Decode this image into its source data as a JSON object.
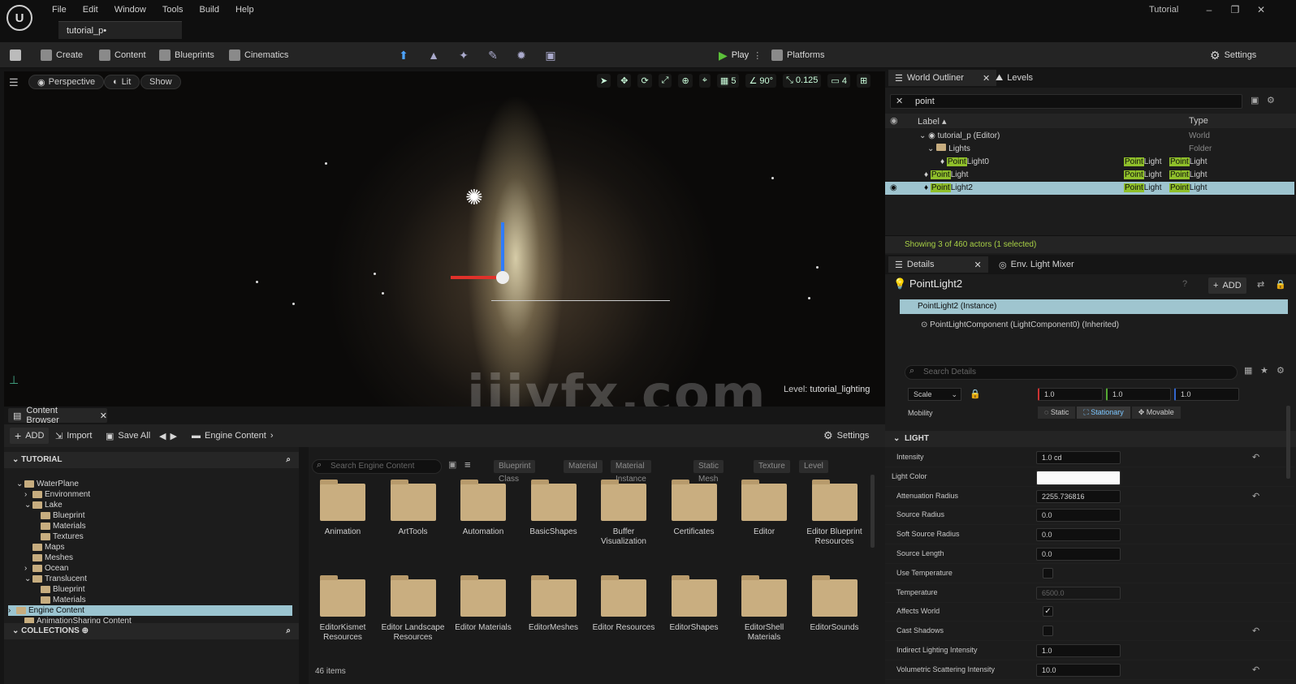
{
  "app": {
    "menu": [
      "File",
      "Edit",
      "Window",
      "Tools",
      "Build",
      "Help"
    ],
    "doc_tab": "tutorial_p•",
    "window_title": "Tutorial"
  },
  "toolbar": {
    "create": "Create",
    "content": "Content",
    "blueprints": "Blueprints",
    "cinematics": "Cinematics",
    "play": "Play",
    "platforms": "Platforms",
    "settings": "Settings"
  },
  "viewport": {
    "perspective": "Perspective",
    "lit": "Lit",
    "show": "Show",
    "grid_snap": "5",
    "rot_snap": "90°",
    "scale_snap": "0.125",
    "cam_speed": "4",
    "level_label": "Level:",
    "level_name": "tutorial_lighting",
    "watermark": "iiivfx.com"
  },
  "content_browser": {
    "tab": "Content Browser",
    "add": "ADD",
    "import": "Import",
    "save_all": "Save All",
    "path": "Engine Content",
    "settings": "Settings",
    "section_tutorial": "TUTORIAL",
    "section_collections": "COLLECTIONS",
    "tree": [
      {
        "label": "WaterPlane",
        "indent": 1,
        "arrow": "⌄"
      },
      {
        "label": "Environment",
        "indent": 2,
        "arrow": "›"
      },
      {
        "label": "Lake",
        "indent": 2,
        "arrow": "⌄"
      },
      {
        "label": "Blueprint",
        "indent": 3,
        "arrow": ""
      },
      {
        "label": "Materials",
        "indent": 3,
        "arrow": ""
      },
      {
        "label": "Textures",
        "indent": 3,
        "arrow": ""
      },
      {
        "label": "Maps",
        "indent": 2,
        "arrow": ""
      },
      {
        "label": "Meshes",
        "indent": 2,
        "arrow": ""
      },
      {
        "label": "Ocean",
        "indent": 2,
        "arrow": "›"
      },
      {
        "label": "Translucent",
        "indent": 2,
        "arrow": "⌄"
      },
      {
        "label": "Blueprint",
        "indent": 3,
        "arrow": ""
      },
      {
        "label": "Materials",
        "indent": 3,
        "arrow": ""
      },
      {
        "label": "Engine Content",
        "indent": 0,
        "arrow": "›",
        "selected": true
      },
      {
        "label": "AnimationSharing Content",
        "indent": 1,
        "arrow": ""
      }
    ],
    "search_placeholder": "Search Engine Content",
    "filters": [
      "Blueprint Class",
      "Material",
      "Material Instance",
      "Static Mesh",
      "Texture",
      "Level"
    ],
    "folders": [
      "Animation",
      "ArtTools",
      "Automation",
      "BasicShapes",
      "Buffer Visualization",
      "Certificates",
      "Editor",
      "Editor Blueprint Resources",
      "EditorKismet Resources",
      "Editor Landscape Resources",
      "Editor Materials",
      "EditorMeshes",
      "Editor Resources",
      "EditorShapes",
      "EditorShell Materials",
      "EditorSounds"
    ],
    "item_count": "46 items"
  },
  "outliner": {
    "tab": "World Outliner",
    "levels_tab": "Levels",
    "search_value": "point",
    "col_label": "Label",
    "col_type": "Type",
    "rows": [
      {
        "label": "tutorial_p (Editor)",
        "type": "World",
        "indent": 0
      },
      {
        "label": "Lights",
        "type": "Folder",
        "indent": 1
      }
    ],
    "light_rows": [
      {
        "hl": "Point",
        "rest": "Light0",
        "t_hl": "",
        "t_rest": "PointLight",
        "type_hl": "Point",
        "type_rest": "Light"
      },
      {
        "hl": "Point",
        "rest": "Light",
        "t_hl": "",
        "t_rest": "PointLight",
        "type_hl": "Point",
        "type_rest": "Light"
      },
      {
        "hl": "Point",
        "rest": "Light2",
        "t_hl": "",
        "t_rest": "PointLight",
        "type_hl": "Point",
        "type_rest": "Light"
      }
    ],
    "status": "Showing 3 of 460 actors (1 selected)"
  },
  "details": {
    "tab": "Details",
    "env_tab": "Env. Light Mixer",
    "actor_name": "PointLight2",
    "add": "ADD",
    "instance": "PointLight2 (Instance)",
    "component": "PointLightComponent (LightComponent0) (Inherited)",
    "search_placeholder": "Search Details",
    "scale_label": "Scale",
    "scale_values": [
      "1.0",
      "1.0",
      "1.0"
    ],
    "mobility_label": "Mobility",
    "mobility_opts": [
      "Static",
      "Stationary",
      "Movable"
    ],
    "light_section": "LIGHT",
    "props": [
      {
        "label": "Intensity",
        "value": "1.0 cd",
        "kind": "text",
        "reset": true
      },
      {
        "label": "Light Color",
        "value": "",
        "kind": "color",
        "reset": false
      },
      {
        "label": "Attenuation Radius",
        "value": "2255.736816",
        "kind": "text",
        "reset": true
      },
      {
        "label": "Source Radius",
        "value": "0.0",
        "kind": "text",
        "reset": false
      },
      {
        "label": "Soft Source Radius",
        "value": "0.0",
        "kind": "text",
        "reset": false
      },
      {
        "label": "Source Length",
        "value": "0.0",
        "kind": "text",
        "reset": false
      },
      {
        "label": "Use Temperature",
        "value": "",
        "kind": "check",
        "reset": false
      },
      {
        "label": "Temperature",
        "value": "6500.0",
        "kind": "text-dim",
        "reset": false
      },
      {
        "label": "Affects World",
        "value": "✓",
        "kind": "check",
        "reset": false
      },
      {
        "label": "Cast Shadows",
        "value": "",
        "kind": "check",
        "reset": true
      },
      {
        "label": "Indirect Lighting Intensity",
        "value": "1.0",
        "kind": "text",
        "reset": false
      },
      {
        "label": "Volumetric Scattering Intensity",
        "value": "10.0",
        "kind": "text",
        "reset": true
      }
    ]
  }
}
